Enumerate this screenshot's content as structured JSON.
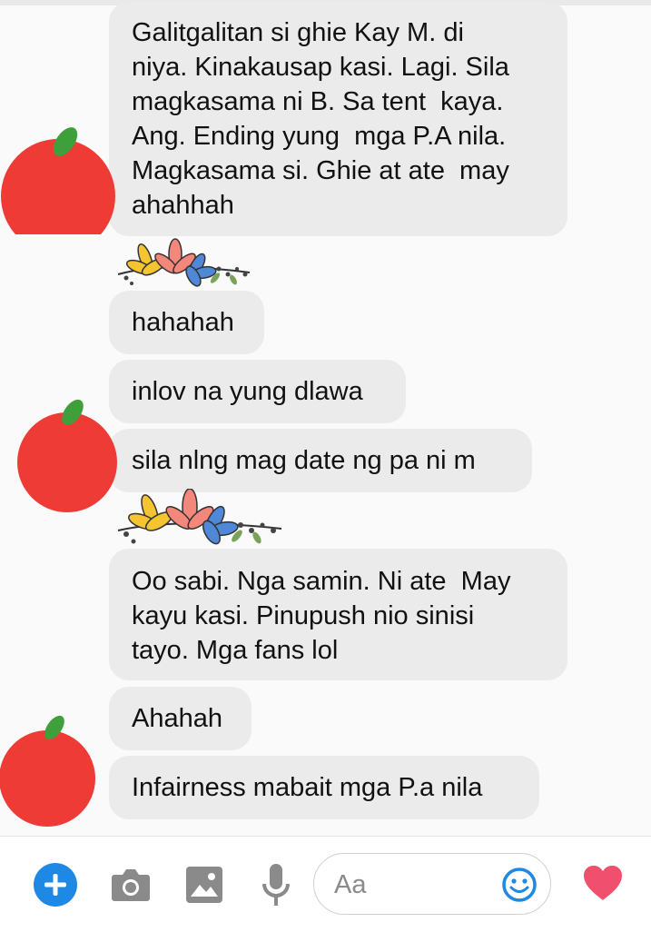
{
  "colors": {
    "bubble_bg": "#ebebeb",
    "accent_blue": "#1e88e5",
    "heart": "#f0506e",
    "apple_red": "#ef3b36",
    "leaf_green": "#3f9f3a"
  },
  "messages": [
    {
      "text": "Galitgalitan si ghie Kay M. di\nniya. Kinakausap kasi. Lagi. Sila\nmagkasama ni B. Sa tent  kaya.\nAng. Ending yung  mga P.A nila.\nMagkasama si. Ghie at ate  may\nahahhah"
    },
    {
      "text": "hahahah"
    },
    {
      "text": "inlov na yung dlawa"
    },
    {
      "text": "sila nlng mag date ng pa ni m"
    },
    {
      "text": "Oo sabi. Nga samin. Ni ate  May\nkayu kasi. Pinupush nio sinisi\ntayo. Mga fans lol"
    },
    {
      "text": "Ahahah"
    },
    {
      "text": "Infairness mabait mga P.a nila"
    }
  ],
  "composer": {
    "placeholder": "Aa",
    "icons": [
      "plus-icon",
      "camera-icon",
      "image-icon",
      "microphone-icon",
      "emoji-icon",
      "heart-icon"
    ]
  },
  "avatar": {
    "icon": "apple-icon"
  },
  "reaction": {
    "icon": "flowers-sticker"
  }
}
